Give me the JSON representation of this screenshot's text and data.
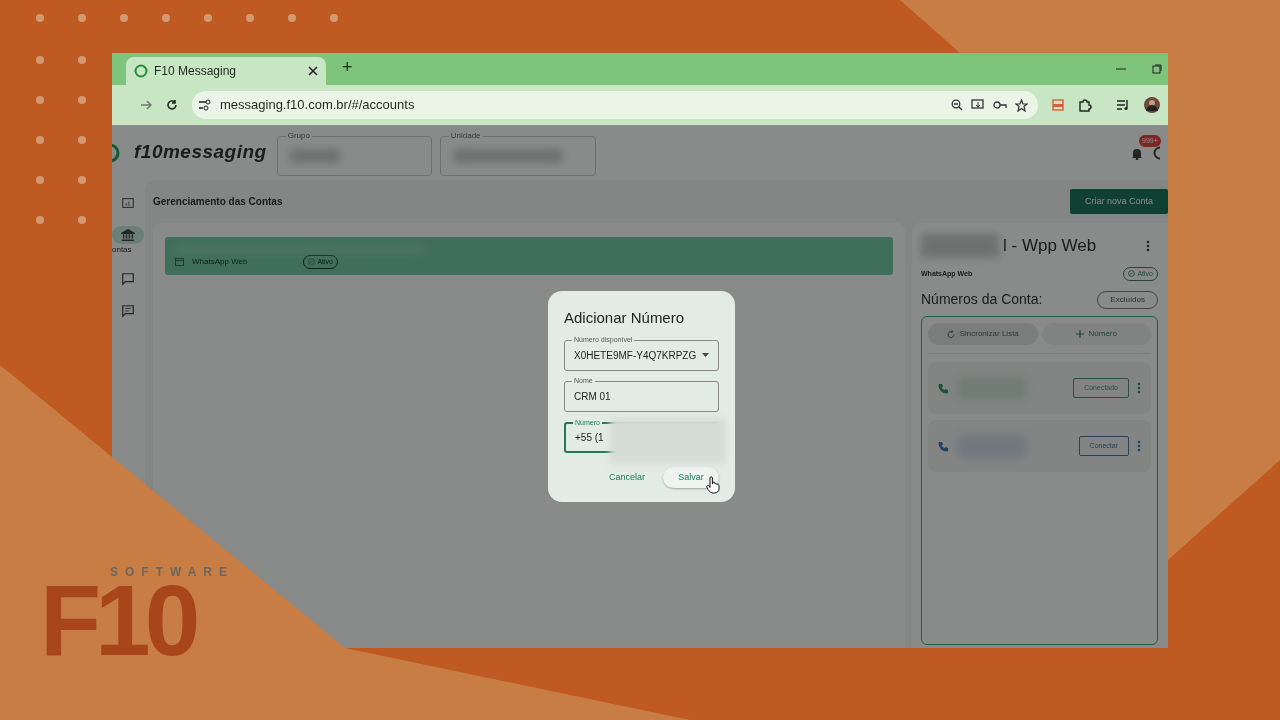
{
  "background": {
    "brand_mark": "F10",
    "brand_word": "SOFTWARE"
  },
  "browser": {
    "tab_title": "F10 Messaging",
    "new_tab": "+",
    "url": "messaging.f10.com.br/#/accounts"
  },
  "app": {
    "logo": "f10messaging",
    "filters": [
      {
        "label": "Grupo"
      },
      {
        "label": "Unidade"
      }
    ],
    "notifications_badge": "999+",
    "nav": [
      {
        "kind": "dashboard",
        "selected": false
      },
      {
        "kind": "bank",
        "label": "ontas",
        "selected": true
      },
      {
        "kind": "chat",
        "selected": false
      },
      {
        "kind": "message",
        "selected": false
      }
    ],
    "page_title": "Gerenciamento das Contas",
    "create_button": "Criar nova Conta",
    "accounts": [
      {
        "channel": "WhatsApp Web",
        "status": "Ativo",
        "selected": true
      }
    ],
    "detail": {
      "title": "l - Wpp Web",
      "channel": "WhatsApp Web",
      "status": "Ativo",
      "section_title": "Números da Conta:",
      "deleted_button": "Excluídos",
      "sync_button": {
        "label": "Sincronizar Lista",
        "disabled": true
      },
      "add_button": "Número",
      "numbers": [
        {
          "status": "Conectado",
          "connected": true
        },
        {
          "status": "Conectar",
          "connected": false
        }
      ]
    }
  },
  "dialog": {
    "title": "Adicionar Número",
    "fields": [
      {
        "kind": "select",
        "label": "Número disponível",
        "value": "X0HETE9MF-Y4Q7KRPZG",
        "focused": false
      },
      {
        "kind": "text",
        "label": "Nome",
        "value": "CRM 01",
        "focused": false
      },
      {
        "kind": "text",
        "label": "Número",
        "value": "+55 (1",
        "focused": true
      }
    ],
    "buttons": [
      {
        "label": "Cancelar",
        "kind": "text"
      },
      {
        "label": "Salvar",
        "kind": "tonal"
      }
    ]
  }
}
